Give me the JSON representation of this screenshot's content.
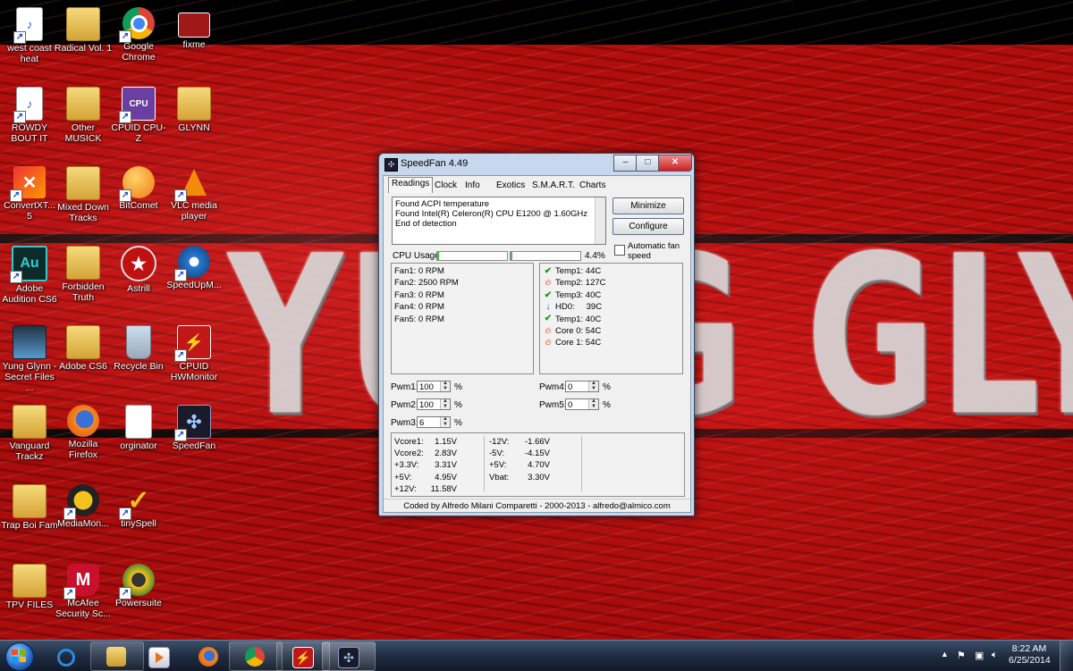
{
  "desktop": {
    "banner_text": "YUNG GLYNN",
    "icons": [
      {
        "label": "west coast heat"
      },
      {
        "label": "Radical Vol. 1"
      },
      {
        "label": "Google Chrome"
      },
      {
        "label": "fixme"
      },
      {
        "label": "ROWDY BOUT IT"
      },
      {
        "label": "Other MUSICK"
      },
      {
        "label": "CPUID CPU-Z"
      },
      {
        "label": "GLYNN"
      },
      {
        "label": "ConvertXT... 5"
      },
      {
        "label": "Mixed Down Tracks"
      },
      {
        "label": "BitComet"
      },
      {
        "label": "VLC media player"
      },
      {
        "label": "Adobe Audition CS6"
      },
      {
        "label": "Forbidden Truth"
      },
      {
        "label": "Astrill"
      },
      {
        "label": "SpeedUpM..."
      },
      {
        "label": "Yung Glynn - Secret Files ..."
      },
      {
        "label": "Adobe CS6"
      },
      {
        "label": "Recycle Bin"
      },
      {
        "label": "CPUID HWMonitor"
      },
      {
        "label": "Vanguard Trackz"
      },
      {
        "label": "Mozilla Firefox"
      },
      {
        "label": "orginator"
      },
      {
        "label": "SpeedFan"
      },
      {
        "label": "Trap Boi Fam"
      },
      {
        "label": "MediaMon..."
      },
      {
        "label": "tinySpell"
      },
      {
        "label": "TPV FILES"
      },
      {
        "label": "McAfee Security Sc..."
      },
      {
        "label": "Powersuite"
      }
    ]
  },
  "speedfan": {
    "title": "SpeedFan 4.49",
    "minimize_glyph": "–",
    "maximize_glyph": "□",
    "close_glyph": "✕",
    "tabs": [
      "Readings",
      "Clock",
      "Info",
      "Exotics",
      "S.M.A.R.T.",
      "Charts"
    ],
    "log_lines": [
      "Found ACPI temperature",
      "Found Intel(R) Celeron(R) CPU E1200 @ 1.60GHz",
      "End of detection"
    ],
    "minimize_button": "Minimize",
    "configure_button": "Configure",
    "auto_fan_label": "Automatic fan speed",
    "cpu_usage_label": "CPU Usage",
    "cpu_usage_value": "4.4%",
    "cpu_core_loads": [
      0.01,
      0.01
    ],
    "fans": [
      "Fan1: 0 RPM",
      "Fan2: 2500 RPM",
      "Fan3: 0 RPM",
      "Fan4: 0 RPM",
      "Fan5: 0 RPM"
    ],
    "temps": [
      {
        "name": "Temp1:",
        "value": "44C",
        "status": "ok"
      },
      {
        "name": "Temp2:",
        "value": "127C",
        "status": "hot"
      },
      {
        "name": "Temp3:",
        "value": "40C",
        "status": "ok"
      },
      {
        "name": "HD0:",
        "value": "39C",
        "status": "down"
      },
      {
        "name": "Temp1:",
        "value": "40C",
        "status": "ok"
      },
      {
        "name": "Core 0:",
        "value": "54C",
        "status": "hot"
      },
      {
        "name": "Core 1:",
        "value": "54C",
        "status": "hot"
      }
    ],
    "pwm": [
      {
        "label": "Pwm1:",
        "value": "100"
      },
      {
        "label": "Pwm2:",
        "value": "100"
      },
      {
        "label": "Pwm3:",
        "value": "6"
      },
      {
        "label": "Pwm4:",
        "value": "0"
      },
      {
        "label": "Pwm5:",
        "value": "0"
      }
    ],
    "pct_sign": "%",
    "voltages_col1": [
      {
        "name": "Vcore1:",
        "value": "1.15V"
      },
      {
        "name": "Vcore2:",
        "value": "2.83V"
      },
      {
        "name": "+3.3V:",
        "value": "3.31V"
      },
      {
        "name": "+5V:",
        "value": "4.95V"
      },
      {
        "name": "+12V:",
        "value": "11.58V"
      }
    ],
    "voltages_col2": [
      {
        "name": "-12V:",
        "value": "-1.66V"
      },
      {
        "name": "-5V:",
        "value": "-4.15V"
      },
      {
        "name": "+5V:",
        "value": "4.70V"
      },
      {
        "name": "Vbat:",
        "value": "3.30V"
      }
    ],
    "footer": "Coded by Alfredo Milani Comparetti - 2000-2013 - alfredo@almico.com"
  },
  "taskbar": {
    "time": "8:22 AM",
    "date": "6/25/2014",
    "tray_arrow": "▲",
    "colors": {
      "accent": "#2a6fd0"
    }
  }
}
